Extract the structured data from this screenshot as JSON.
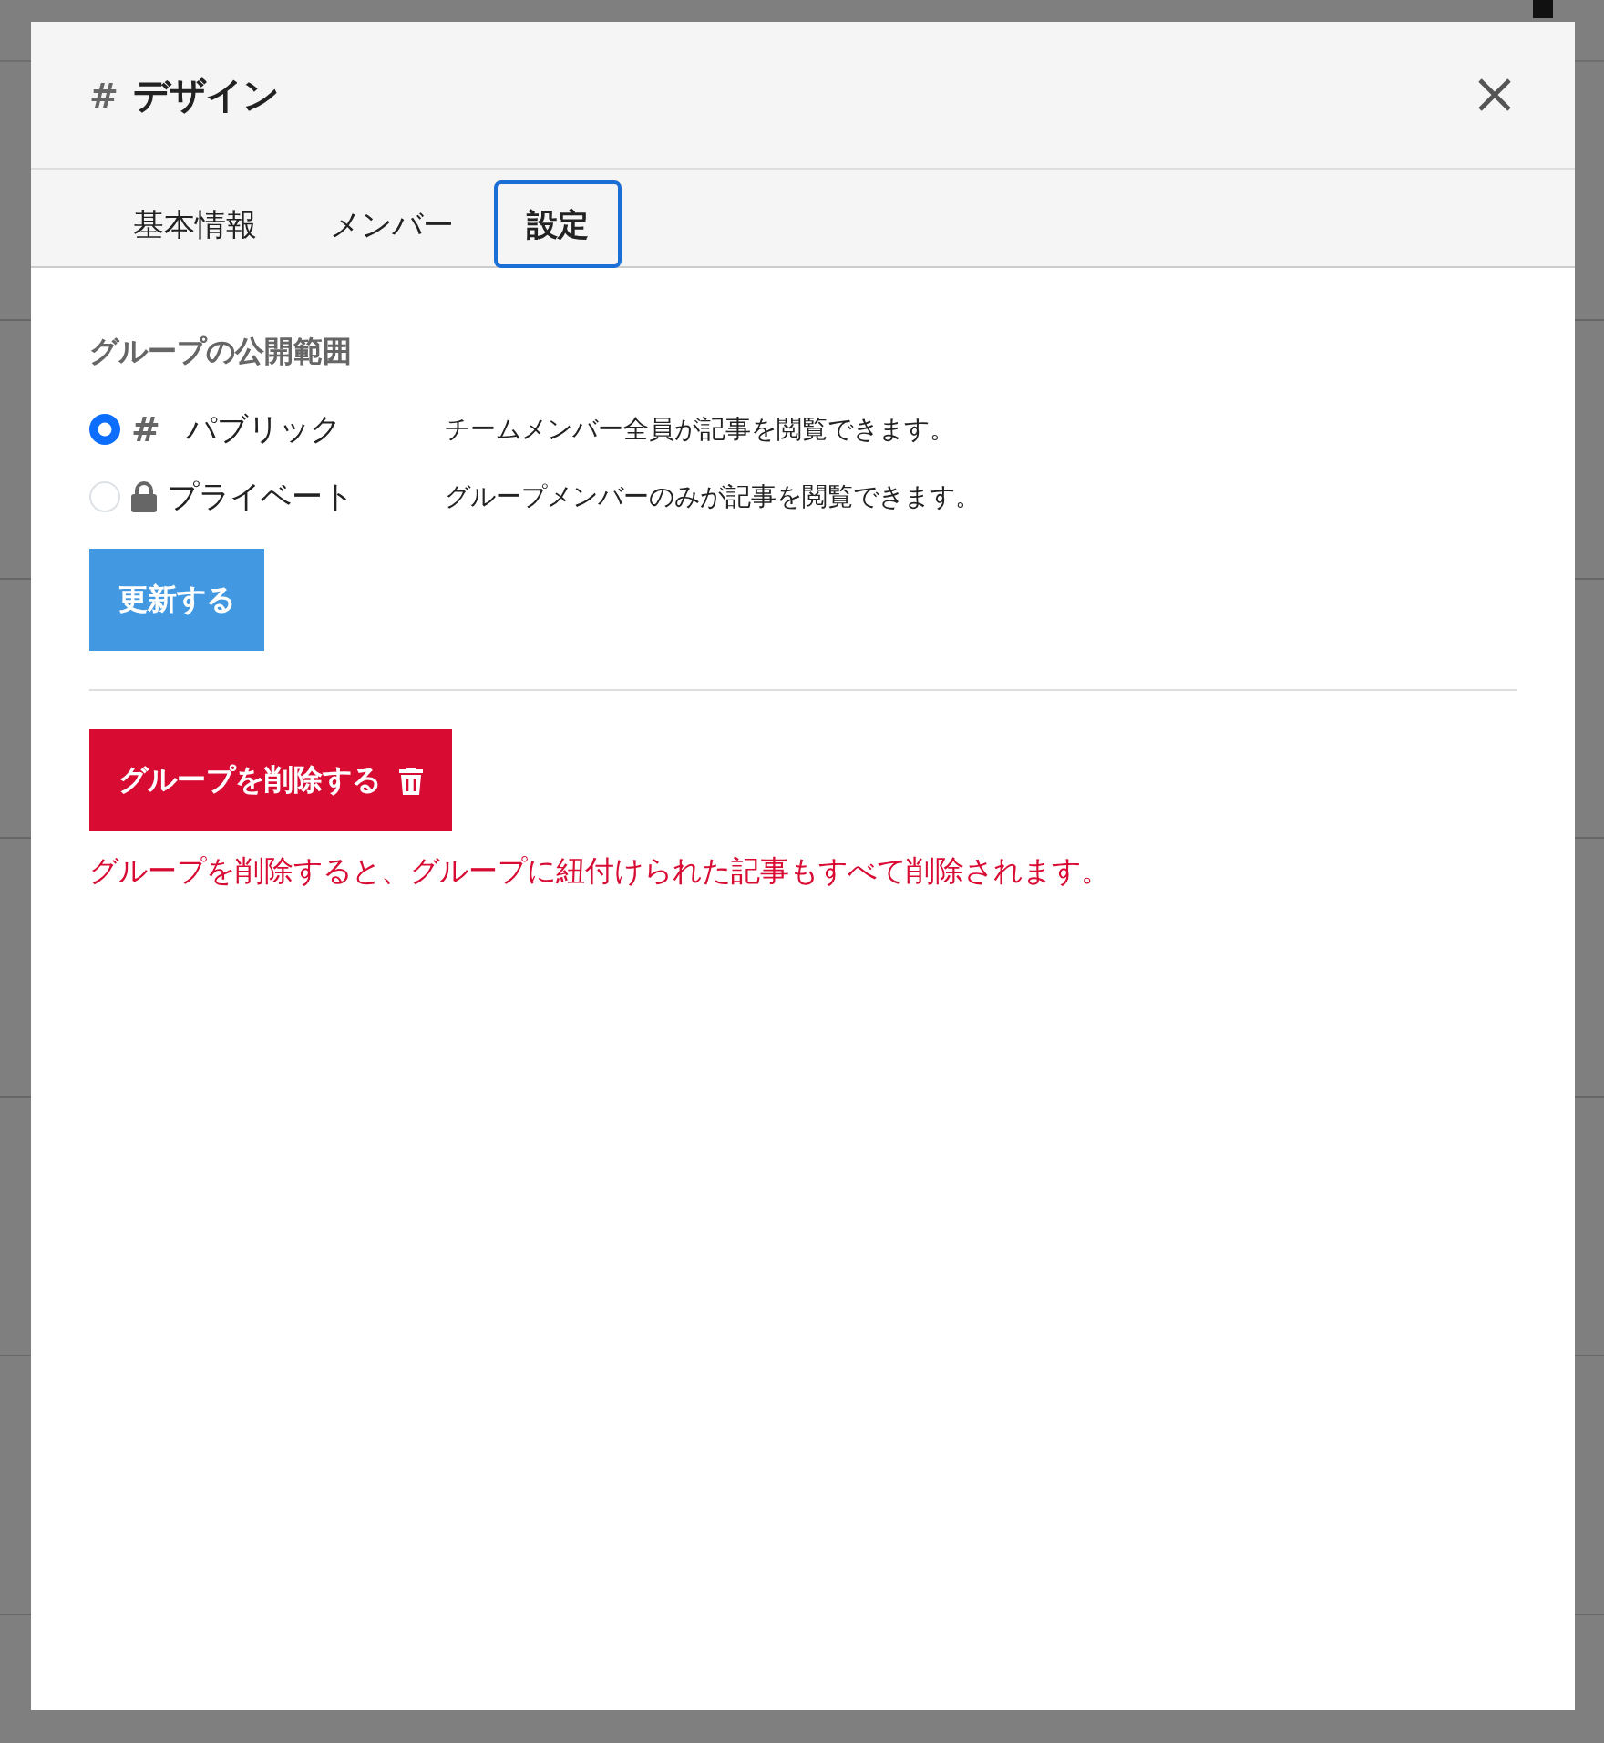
{
  "background": {
    "rows": [
      {},
      {},
      {},
      {},
      {},
      {}
    ]
  },
  "modal": {
    "title_icon": "#",
    "title": "デザイン",
    "tabs": [
      {
        "label": "基本情報",
        "selected": false
      },
      {
        "label": "メンバー",
        "selected": false
      },
      {
        "label": "設定",
        "selected": true
      }
    ],
    "visibility": {
      "label": "グループの公開範囲",
      "options": [
        {
          "kind": "public",
          "icon": "#",
          "label": "パブリック",
          "description": "チームメンバー全員が記事を閲覧できます。",
          "selected": true
        },
        {
          "kind": "private",
          "label": "プライベート",
          "description": "グループメンバーのみが記事を閲覧できます。",
          "selected": false
        }
      ]
    },
    "update_button": "更新する",
    "delete_button": "グループを削除する",
    "delete_warning": "グループを削除すると、グループに紐付けられた記事もすべて削除されます。"
  }
}
